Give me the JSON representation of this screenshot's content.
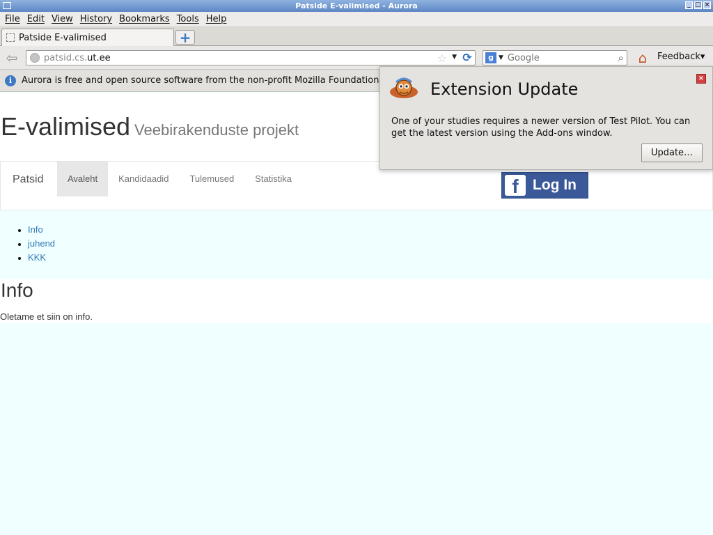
{
  "window": {
    "title": "Patside E-valimised - Aurora"
  },
  "menu": [
    "File",
    "Edit",
    "View",
    "History",
    "Bookmarks",
    "Tools",
    "Help"
  ],
  "tab": {
    "label": "Patside E-valimised"
  },
  "url": {
    "host_dim": "patsid.cs.",
    "host": "ut.ee"
  },
  "search": {
    "placeholder": "Google"
  },
  "toolbar": {
    "feedback": "Feedback▾"
  },
  "notification": {
    "text": "Aurora is free and open source software from the non-profit Mozilla Foundation."
  },
  "site": {
    "title": "E-valimised",
    "subtitle": "Veebirakenduste projekt"
  },
  "nav": {
    "brand": "Patsid",
    "links": [
      "Avaleht",
      "Kandidaadid",
      "Tulemused",
      "Statistika"
    ]
  },
  "facebook": {
    "label": "Log In"
  },
  "sidelist": [
    "Info",
    "juhend",
    "KKK"
  ],
  "content": {
    "heading": "Info",
    "text": "Oletame et siin on info."
  },
  "panel": {
    "title": "Extension Update",
    "message": "One of your studies requires a newer version of Test Pilot. You can get the latest version using the Add-ons window.",
    "button": "Update…"
  },
  "colors": {
    "accent": "#337ab7",
    "facebook": "#3b5998",
    "page_bg": "#f0ffff"
  }
}
